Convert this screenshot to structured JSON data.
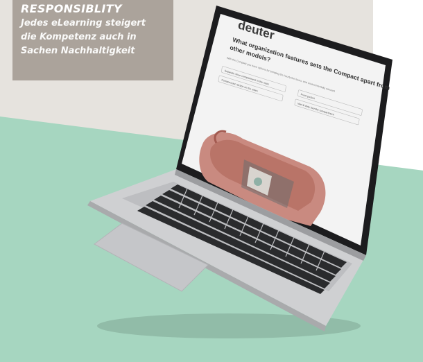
{
  "caption": {
    "title": "RESPONSIBLITY",
    "line1": "Jedes eLearning steigert",
    "line2": "die Kompetenz auch in",
    "line3": "Sachen Nachhaltigkeit"
  },
  "screen": {
    "brand": "deuter",
    "question_line1": "What organization features sets the Compact apart from",
    "question_line2": "other models?",
    "instruction": "With the Compact you have options for bringing the hourly fee items, and environmentally relevant",
    "options": [
      "Separate shoe compartment in the main",
      "Front pocket",
      "Compression straps on the sides",
      "Wet & dirty laundry compartment"
    ]
  },
  "colors": {
    "gray_panel": "#e6e3de",
    "caption_bg": "#aba39b",
    "green": "#a6d6c0",
    "laptop_body": "#cfd0d2",
    "keys": "#2a2b2d",
    "backpack": "#c98a80"
  }
}
